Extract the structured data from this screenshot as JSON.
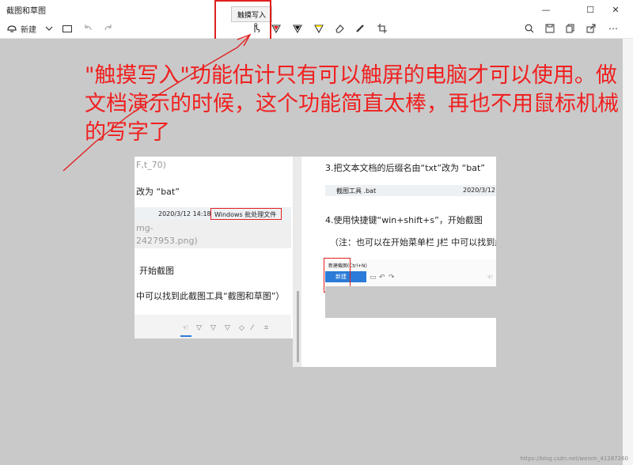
{
  "window": {
    "title": "截图和草图",
    "controls": {
      "minimize": "—",
      "maximize": "☐",
      "close": "✕"
    }
  },
  "toolbar": {
    "new_label": "新建",
    "tooltip": "触摸写入",
    "icons": [
      "new-snip-icon",
      "chevron-down-icon",
      "folder-icon",
      "undo-icon",
      "redo-icon",
      "touch-writing-icon",
      "ballpoint-pen-icon",
      "pencil-icon",
      "highlighter-icon",
      "eraser-icon",
      "ruler-icon",
      "crop-icon",
      "zoom-icon",
      "save-icon",
      "copy-icon",
      "share-icon",
      "more-icon"
    ]
  },
  "annotation": {
    "text": "\"触摸写入\"功能估计只有可以触屏的电脑才可以使用。做文档演示的时候，这个功能简直太棒，再也不用鼠标机械的写字了",
    "color": "#f02020"
  },
  "shot_left": {
    "line1": "F,t_70)",
    "line2": "改为 “bat”",
    "date": "2020/3/12 14:18",
    "type": "Windows 批处理文件",
    "mg": "mg-",
    "png": "2427953.png)",
    "step": "开始截图",
    "tip": "中可以找到此截图工具“截图和草图”）"
  },
  "shot_right": {
    "step3": "3.把文本文档的后缀名由“txt”改为 “bat”",
    "file": "截图工具 .bat",
    "file_date": "2020/3/12 14:",
    "step4": "4.使用快捷键“win+shift+s”，开始截图",
    "note": "（注：也可以在开始菜单栏 J栏 中可以找到此截",
    "mini_title": "新建截图(Ctrl+N)",
    "mini_new": "新建"
  },
  "watermark": "https://blog.csdn.net/weixin_41287260"
}
